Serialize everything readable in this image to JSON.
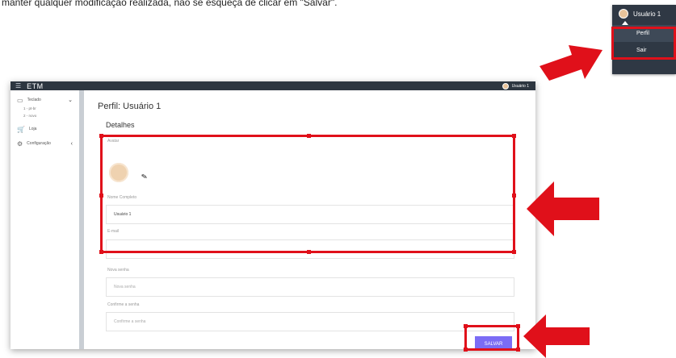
{
  "instruction": "manter qualquer modificação realizada, não se esqueça de clicar em \"Salvar\".",
  "inset": {
    "user_name": "Usuário 1",
    "menu": [
      "Perfil",
      "Sair"
    ]
  },
  "app": {
    "brand": "ETM",
    "user_name": "Usuário 1",
    "sidebar": {
      "items": [
        {
          "label": "Teclado",
          "icon": "keyboard-icon"
        },
        {
          "label": "Loja",
          "icon": "cart-icon"
        },
        {
          "label": "Configuração",
          "icon": "gear-icon"
        }
      ],
      "subitems": [
        "1 - pt-br",
        "2 - novo"
      ]
    },
    "page_title": "Perfil: Usuário 1",
    "section_title": "Detalhes",
    "fields": {
      "avatar_label": "Avatar",
      "name_label": "Nome Completo",
      "name_value": "Usuário 1",
      "email_label": "E-mail",
      "email_value": "",
      "new_password_label": "Nova senha",
      "new_password_placeholder": "Nova senha",
      "confirm_password_label": "Confirme a senha",
      "confirm_password_placeholder": "Confirme a senha"
    },
    "save_label": "SALVAR"
  },
  "colors": {
    "highlight": "#e0101a",
    "topbar": "#2d3640",
    "save_button": "#7b6cf5"
  }
}
